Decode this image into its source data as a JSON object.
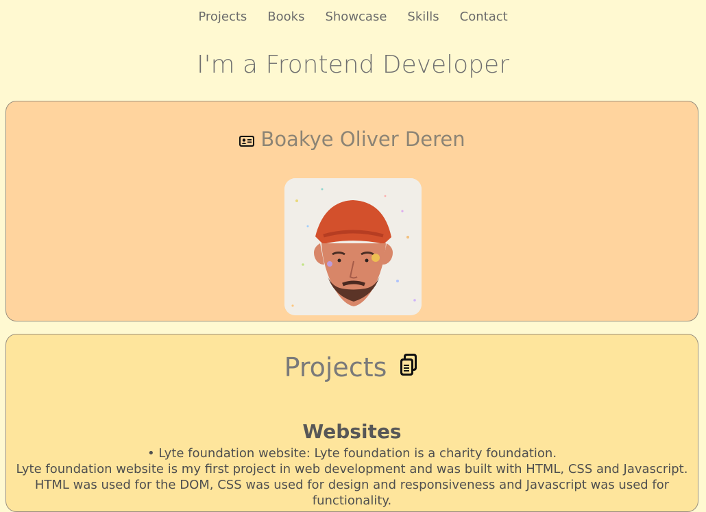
{
  "nav": {
    "items": [
      "Projects",
      "Books",
      "Showcase",
      "Skills",
      "Contact"
    ]
  },
  "hero": {
    "title": "I'm a Frontend Developer"
  },
  "profile": {
    "name": "Boakye Oliver Deren"
  },
  "projects": {
    "title": "Projects",
    "subsection_title": "Websites",
    "description": [
      "• Lyte foundation website: Lyte foundation is a charity foundation.",
      "Lyte foundation website is my first project in web development and was built with HTML, CSS and Javascript.",
      "HTML was used for the DOM, CSS was used for design and responsiveness and Javascript was used for functionality."
    ]
  },
  "colors": {
    "page_background": "#fff9d1",
    "profile_card": "#ffd49e",
    "projects_card": "#fee59c"
  },
  "icons": {
    "profile": "id-card-icon",
    "projects": "copy-icon"
  }
}
